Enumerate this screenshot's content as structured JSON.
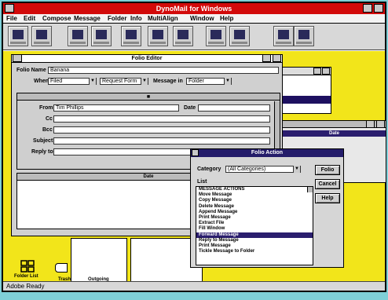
{
  "app": {
    "title": "DynoMail for Windows",
    "status": "Adobe Ready"
  },
  "menu": [
    "File",
    "Edit",
    "Compose",
    "Message",
    "Folder",
    "Info",
    "MultiAlign",
    "Window",
    "Help"
  ],
  "toolbar": {
    "left_count": 7,
    "right_count": 6,
    "extra_count": 2
  },
  "folio": {
    "title": "Folio Editor",
    "name_label": "Folio Name",
    "name_value": "Banana",
    "when_label": "When",
    "when_value": "Filed",
    "type_value": "Request Form",
    "msg_label": "Message in",
    "msg_value": "Folder",
    "from_label": "From",
    "from_value": "Tim Phillips",
    "date_label": "Date",
    "cc_label": "Cc",
    "bcc_label": "Bcc",
    "subject_label": "Subject",
    "reply_label": "Reply to",
    "body_header": "Date"
  },
  "right_win": {
    "header": "Date"
  },
  "action_dialog": {
    "title": "Folio Action",
    "category_label": "Category",
    "category_value": "(All Categories)",
    "list_label": "List",
    "items": [
      "MESSAGE ACTIONS",
      "Move Message",
      "Copy Message",
      "Delete Message",
      "Append Message",
      "Print Message",
      "Extract File",
      "Fill Window",
      "Forward Message",
      "Reply to Message",
      "Print Message",
      "Tickle Message to Folder"
    ],
    "selected_index": 9,
    "buttons": [
      "Folio",
      "Cancel",
      "Help"
    ]
  },
  "bottom": {
    "folder_label": "Folder List",
    "trash_label": "Trash",
    "outgoing_label": "Outgoing"
  }
}
